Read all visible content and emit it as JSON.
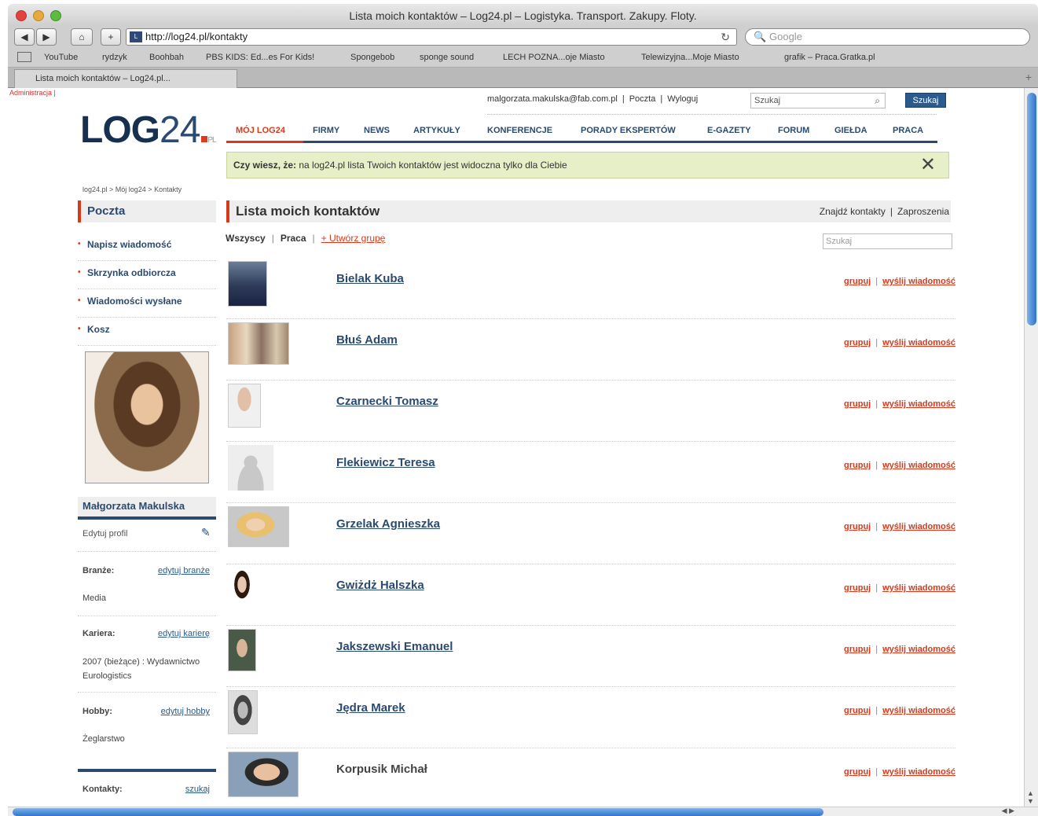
{
  "browser": {
    "window_title": "Lista moich kontaktów – Log24.pl – Logistyka. Transport. Zakupy. Floty.",
    "url": "http://log24.pl/kontakty",
    "search_placeholder": "Google",
    "tab_title": "Lista moich kontaktów – Log24.pl...",
    "bookmarks": [
      "YouTube",
      "rydzyk",
      "Boohbah",
      "PBS KIDS: Ed...es For Kids!",
      "Spongebob",
      "sponge sound",
      "LECH POZNA...oje Miasto",
      "Telewizyjna...Moje Miasto",
      "grafik – Praca.Gratka.pl"
    ]
  },
  "page": {
    "admin_link": "Administracja |",
    "logo": {
      "text": "LOG",
      "number": "24",
      "suffix": "PL"
    },
    "userbar": {
      "email": "malgorzata.makulska@fab.com.pl",
      "mail": "Poczta",
      "logout": "Wyloguj"
    },
    "top_search": {
      "placeholder": "Szukaj",
      "button": "Szukaj"
    },
    "nav": [
      "MÓJ LOG24",
      "FIRMY",
      "NEWS",
      "ARTYKUŁY",
      "KONFERENCJE",
      "PORADY EKSPERTÓW",
      "E-GAZETY",
      "FORUM",
      "GIEŁDA",
      "PRACA"
    ],
    "info": {
      "bold": "Czy wiesz, że:",
      "text": " na log24.pl lista Twoich kontaktów jest widoczna tylko dla Ciebie"
    },
    "breadcrumb": "log24.pl > Mój log24 > Kontakty",
    "sidebar": {
      "heading": "Poczta",
      "menu": [
        "Napisz wiadomość",
        "Skrzynka odbiorcza",
        "Wiadomości wysłane",
        "Kosz"
      ],
      "profile_name": "Małgorzata Makulska",
      "edit_profile": "Edytuj profil",
      "industry_label": "Branże:",
      "industry_link": "edytuj branże",
      "industry_value": "Media",
      "career_label": "Kariera:",
      "career_link": "edytuj karierę",
      "career_value_1": "2007 (bieżące) : Wydawnictwo",
      "career_value_2": "Eurologistics",
      "hobby_label": "Hobby:",
      "hobby_link": "edytuj hobby",
      "hobby_value": "Żeglarstwo",
      "contacts_label": "Kontakty:",
      "contacts_link": "szukaj"
    },
    "content": {
      "heading": "Lista moich kontaktów",
      "find_contacts": "Znajdź kontakty",
      "invitations": "Zaproszenia",
      "filter_all": "Wszyscy",
      "filter_work": "Praca",
      "create_group": "+ Utwórz grupę",
      "list_search_placeholder": "Szukaj",
      "action_group": "grupuj",
      "action_message": "wyślij wiadomość",
      "contacts": [
        {
          "name": "Bielak Kuba"
        },
        {
          "name": "Błuś Adam"
        },
        {
          "name": "Czarnecki Tomasz"
        },
        {
          "name": "Flekiewicz Teresa"
        },
        {
          "name": "Grzelak Agnieszka"
        },
        {
          "name": "Gwiżdż Halszka"
        },
        {
          "name": "Jakszewski Emanuel"
        },
        {
          "name": "Jędra Marek"
        },
        {
          "name": "Korpusik Michał"
        }
      ]
    }
  }
}
